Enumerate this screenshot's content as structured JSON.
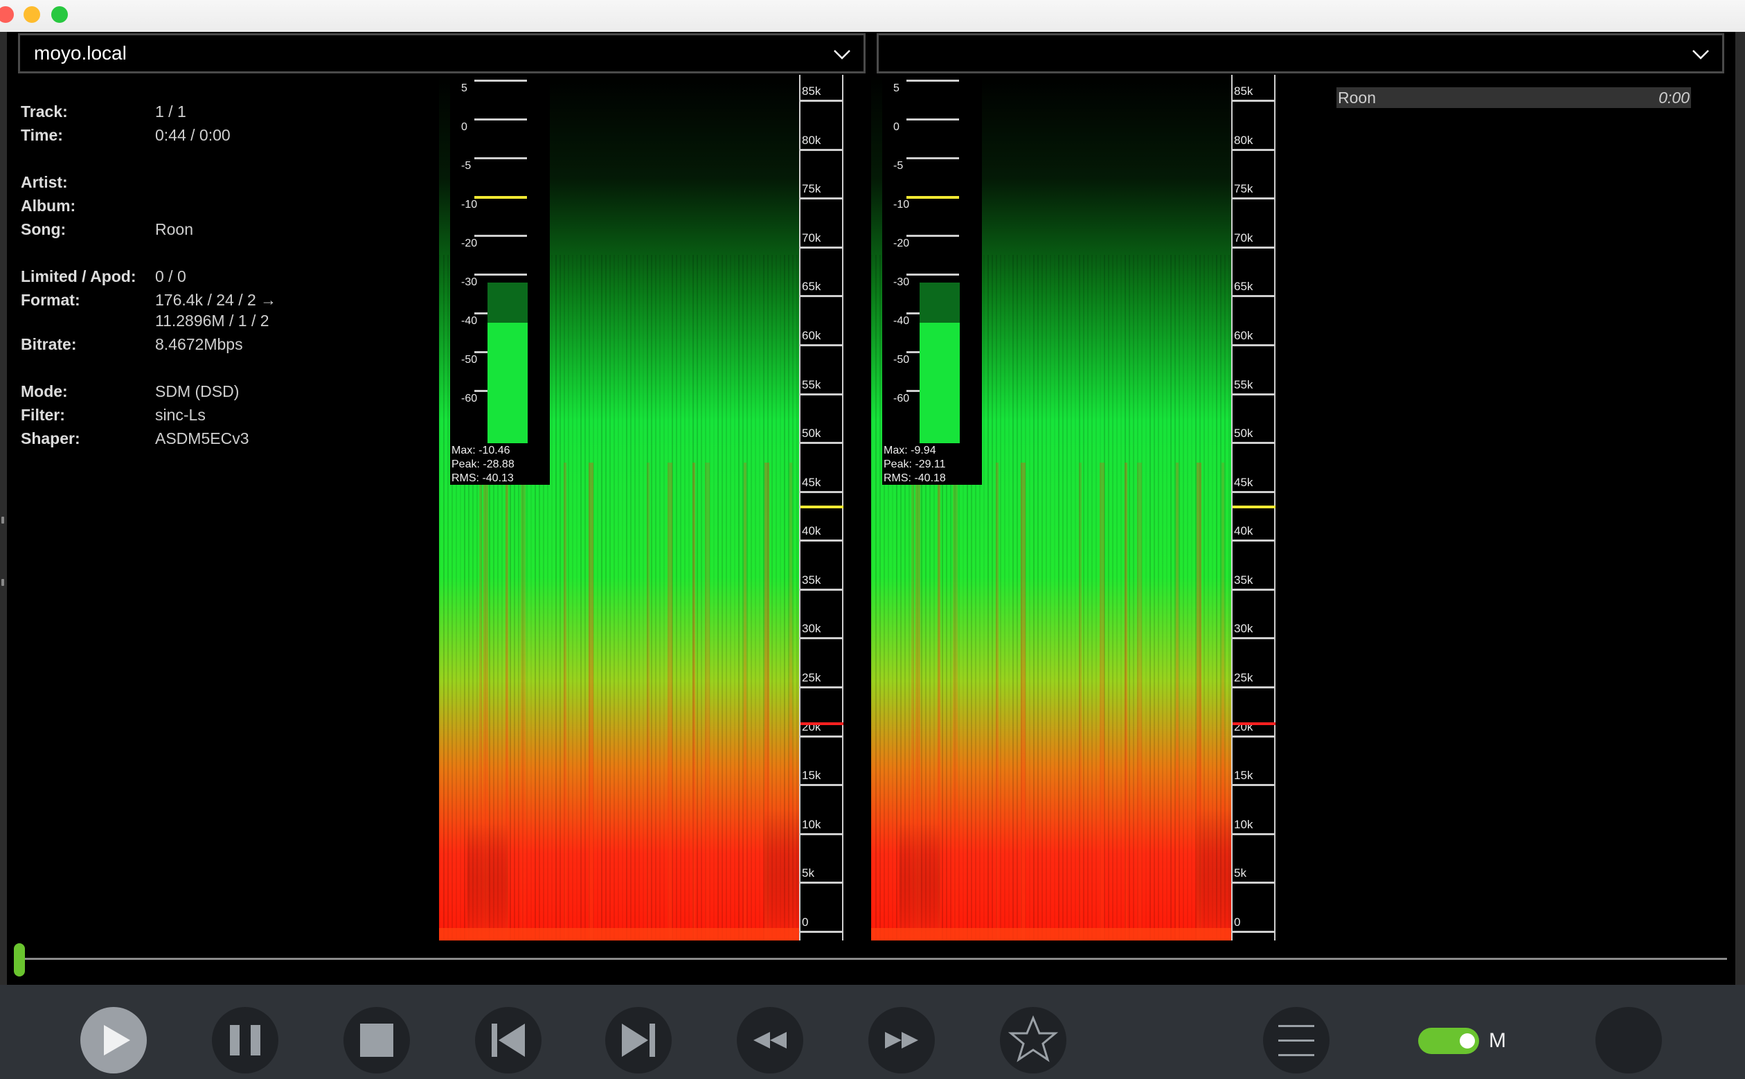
{
  "device": {
    "selected": "moyo.local",
    "secondary": ""
  },
  "info": [
    {
      "label": "Track:",
      "value": "1 / 1",
      "gap": 0
    },
    {
      "label": "Time:",
      "value": "0:44 / 0:00",
      "gap": 0
    },
    {
      "label": "Artist:",
      "value": "",
      "gap": 1
    },
    {
      "label": "Album:",
      "value": "",
      "gap": 0
    },
    {
      "label": "Song:",
      "value": "Roon",
      "gap": 0
    },
    {
      "label": "Limited / Apod:",
      "value": "0 / 0",
      "gap": 1
    },
    {
      "label": "Format:",
      "value": "176.4k / 24 / 2 →",
      "value2": "11.2896M / 1 / 2",
      "gap": 0
    },
    {
      "label": "Bitrate:",
      "value": "8.4672Mbps",
      "gap": 0
    },
    {
      "label": "Mode:",
      "value": "SDM (DSD)",
      "gap": 1
    },
    {
      "label": "Filter:",
      "value": "sinc-Ls",
      "gap": 0
    },
    {
      "label": "Shaper:",
      "value": "ASDM5ECv3",
      "gap": 0
    }
  ],
  "spectrum": {
    "freq_labels": [
      "85k",
      "80k",
      "75k",
      "70k",
      "65k",
      "60k",
      "55k",
      "50k",
      "45k",
      "40k",
      "35k",
      "30k",
      "25k",
      "20k",
      "15k",
      "10k",
      "5k",
      "0"
    ],
    "meter_labels": [
      "5",
      "0",
      "-5",
      "-10",
      "-20",
      "-30",
      "-40",
      "-50",
      "-60"
    ],
    "channels": [
      {
        "max": "Max: -10.46",
        "peak": "Peak: -28.88",
        "rms": "RMS: -40.13",
        "level_frac": 0.75,
        "peak_frac": 1.0
      },
      {
        "max": "Max: -9.94",
        "peak": "Peak: -29.11",
        "rms": "RMS: -40.18",
        "level_frac": 0.75,
        "peak_frac": 1.0
      }
    ],
    "colors": {
      "green": "#17e43a",
      "red": "#ff2a10",
      "yellow_marker": "#f2e832",
      "red_marker": "#ff2020"
    }
  },
  "queue": {
    "title": "Roon",
    "time": "0:00"
  },
  "toolbar": {
    "buttons": [
      "play-icon",
      "pause-icon",
      "stop-icon",
      "skip-previous-icon",
      "skip-next-icon",
      "rewind-icon",
      "fast-forward-icon",
      "star-icon",
      "menu-icon"
    ],
    "toggle_label": "M",
    "accent": "#6ac42f"
  }
}
